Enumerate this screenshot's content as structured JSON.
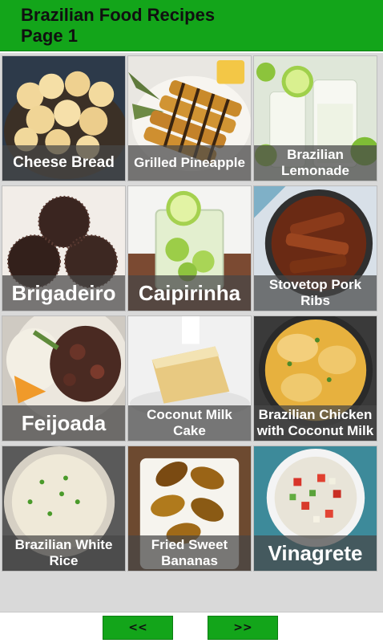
{
  "header": {
    "title_line1": "Brazilian Food Recipes",
    "title_line2": "Page 1"
  },
  "recipes": [
    {
      "name": "Cheese Bread",
      "icon": "cheese-bread-photo"
    },
    {
      "name": "Grilled Pineapple",
      "icon": "grilled-pineapple-photo"
    },
    {
      "name": "Brazilian Lemonade",
      "icon": "lemonade-photo"
    },
    {
      "name": "Brigadeiro",
      "icon": "brigadeiro-photo"
    },
    {
      "name": "Caipirinha",
      "icon": "caipirinha-photo"
    },
    {
      "name": "Stovetop Pork Ribs",
      "icon": "pork-ribs-photo"
    },
    {
      "name": "Feijoada",
      "icon": "feijoada-photo"
    },
    {
      "name": "Coconut Milk Cake",
      "icon": "coconut-cake-photo"
    },
    {
      "name": "Brazilian Chicken with Coconut Milk",
      "icon": "chicken-coconut-photo"
    },
    {
      "name": "Brazilian White Rice",
      "icon": "white-rice-photo"
    },
    {
      "name": "Fried Sweet Bananas",
      "icon": "fried-bananas-photo"
    },
    {
      "name": "Vinagrete",
      "icon": "vinagrete-photo"
    }
  ],
  "nav": {
    "prev_label": "<<",
    "next_label": ">>"
  },
  "colors": {
    "header_green": "#13a51a",
    "caption_overlay": "rgba(70,70,70,0.72)"
  }
}
